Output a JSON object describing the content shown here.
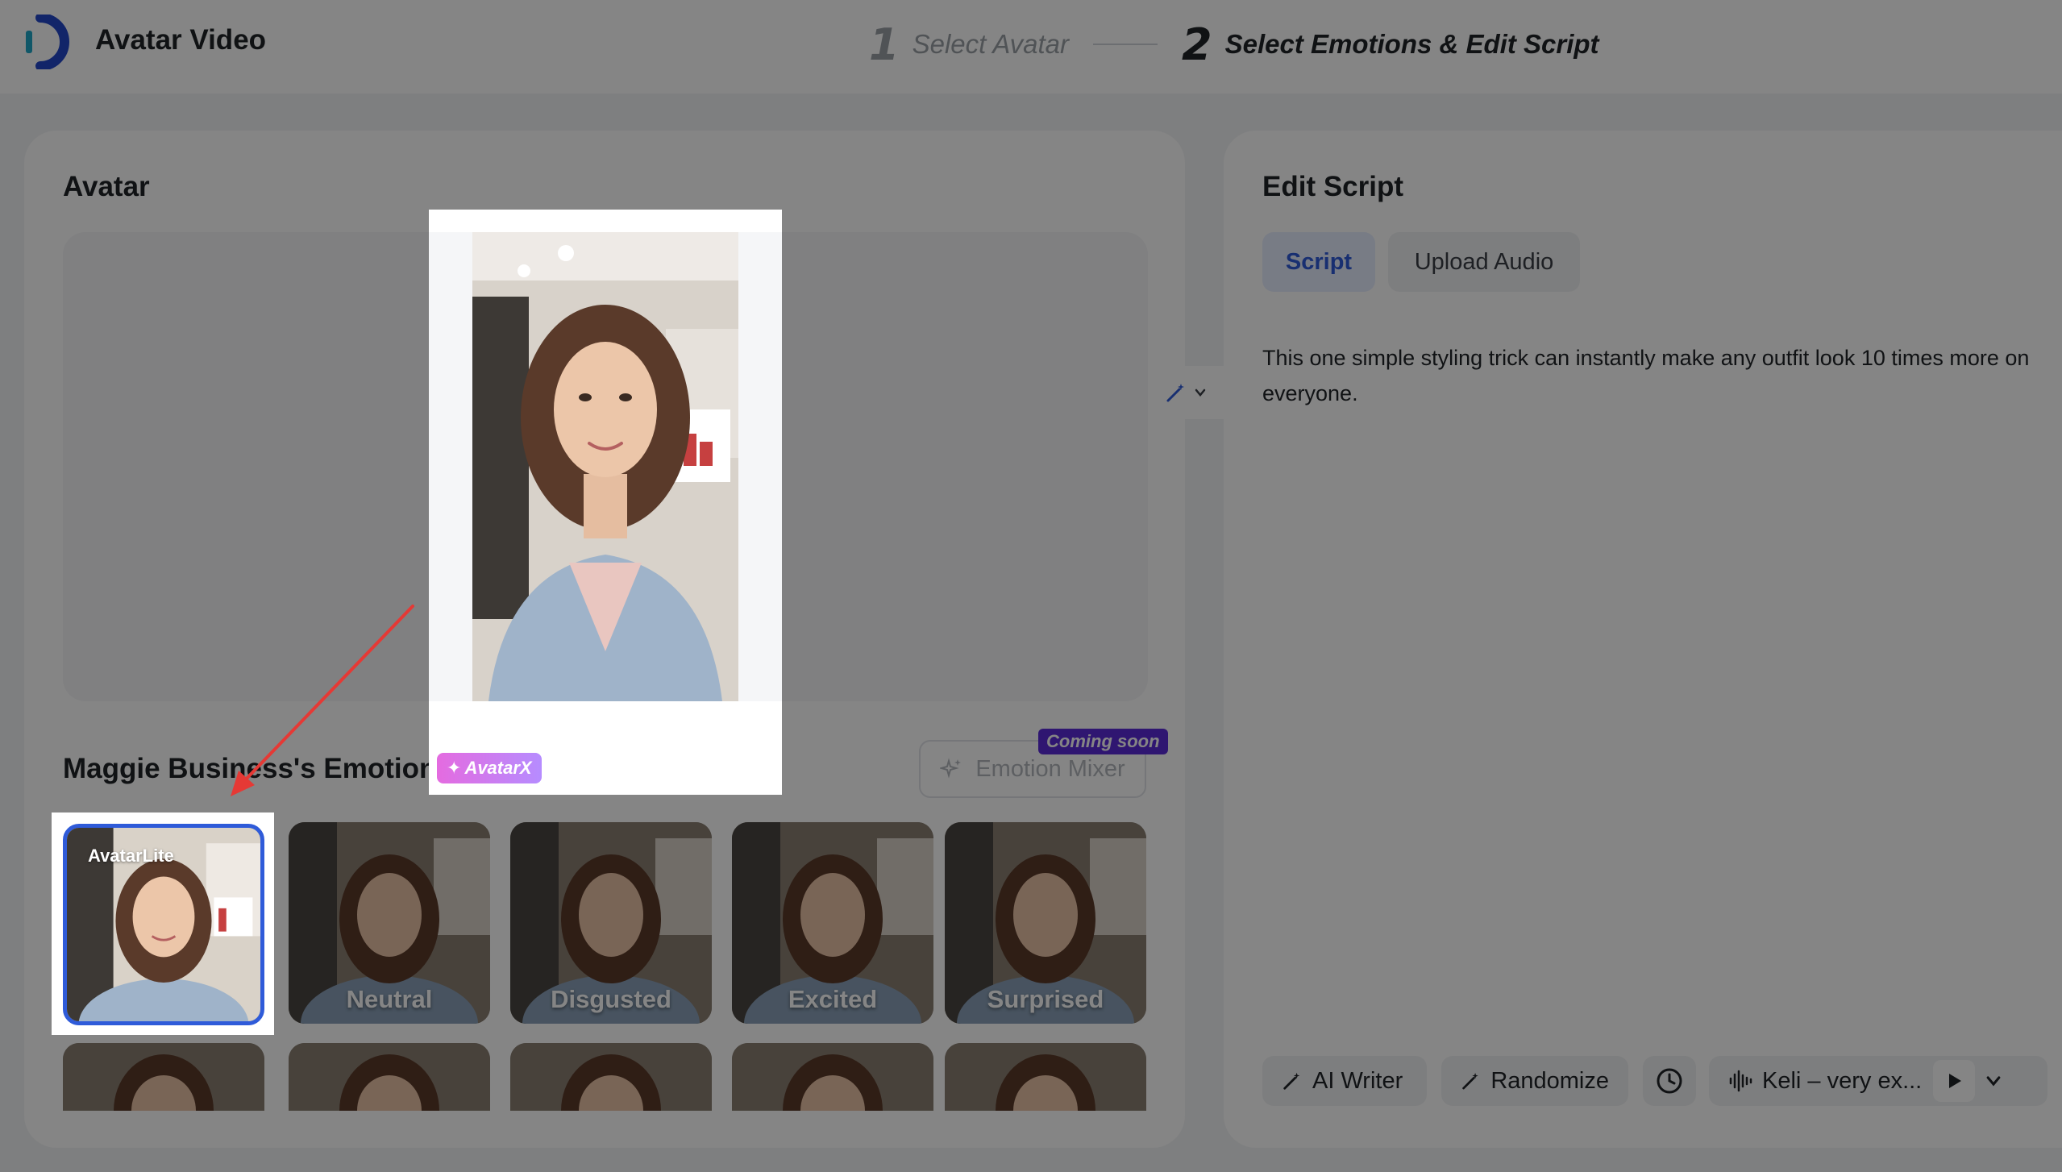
{
  "header": {
    "app_title": "Avatar Video",
    "steps": [
      {
        "number": "1",
        "label": "Select Avatar"
      },
      {
        "number": "2",
        "label": "Select Emotions & Edit Script"
      }
    ]
  },
  "avatar_panel": {
    "heading": "Avatar",
    "preview_badge": "AvatarX",
    "emotions_heading": "Maggie Business's Emotion",
    "emotion_mixer_label": "Emotion Mixer",
    "coming_soon_label": "Coming soon",
    "emotion_tiles": [
      {
        "label": "",
        "badge": "AvatarLite",
        "selected": true
      },
      {
        "label": "Neutral",
        "badge": "",
        "selected": false
      },
      {
        "label": "Disgusted",
        "badge": "",
        "selected": false
      },
      {
        "label": "Excited",
        "badge": "",
        "selected": false
      },
      {
        "label": "Surprised",
        "badge": "",
        "selected": false
      }
    ]
  },
  "script_panel": {
    "heading": "Edit Script",
    "tabs": [
      {
        "label": "Script",
        "active": true
      },
      {
        "label": "Upload Audio",
        "active": false
      }
    ],
    "script_text": "This one simple styling trick can instantly make any outfit look 10 times more on everyone.",
    "ai_writer_label": "AI Writer",
    "randomize_label": "Randomize",
    "voice_label": "Keli – very ex..."
  },
  "colors": {
    "accent": "#2f5bd9",
    "coming_soon_bg": "#5b2bd8",
    "arrow": "#e53935"
  }
}
